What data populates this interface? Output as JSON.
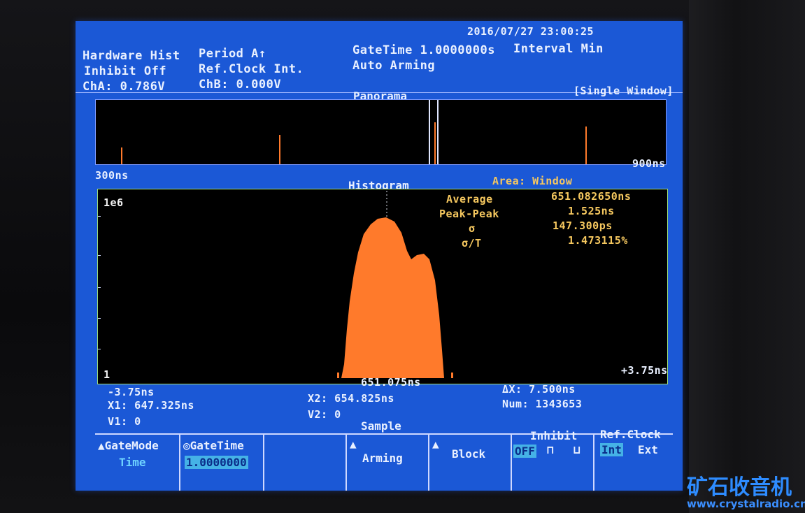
{
  "status": {
    "datetime": "2016/07/27 23:00:25",
    "mode": "Hardware Hist",
    "inhibit": "Inhibit Off",
    "cha": "ChA:  0.786V",
    "measure": "Period A↑",
    "refclock": "Ref.Clock Int.",
    "chb": "ChB:  0.000V",
    "gatetime": "GateTime 1.0000000s",
    "interval": "Interval Min",
    "arming": "Auto Arming"
  },
  "panorama": {
    "title": "Panorama",
    "window_mode": "[Single Window]",
    "x_min": "300ns",
    "x_max": "900ns"
  },
  "histogram": {
    "title": "Histogram",
    "area": "Area: Window",
    "y_top": "1e6",
    "y_bottom": "1",
    "x_left": "-3.75ns",
    "x_center": "651.075ns",
    "x_right": "+3.75ns",
    "stats": [
      {
        "label": "Average",
        "value": "651.082650ns"
      },
      {
        "label": "Peak-Peak",
        "value": "1.525ns"
      },
      {
        "label": "σ",
        "value": "147.300ps"
      },
      {
        "label": "σ/T",
        "value": "1.473115%"
      }
    ]
  },
  "markers": {
    "x1": "X1: 647.325ns",
    "v1": "V1: 0",
    "x2": "X2: 654.825ns",
    "v2": "V2: 0",
    "dx": "ΔX: 7.500ns",
    "num": "Num: 1343653"
  },
  "sample_label": "Sample",
  "softkeys": {
    "gatemode_label": "GateMode",
    "gatemode_value": "Time",
    "gatetime_label": "GateTime",
    "gatetime_value": "1.0000000",
    "arming": "Arming",
    "block": "Block",
    "inhibit_label": "Inhibit",
    "inhibit_off": "OFF",
    "refclock_label": "Ref.Clock",
    "refclock_int": "Int",
    "refclock_ext": "Ext"
  },
  "watermark": {
    "text": "矿石收音机",
    "url": "www.crystalradio.cn"
  },
  "colors": {
    "screen_bg": "#1b58d6",
    "trace": "#ff7a2b",
    "stat_text": "#f6c85f"
  }
}
